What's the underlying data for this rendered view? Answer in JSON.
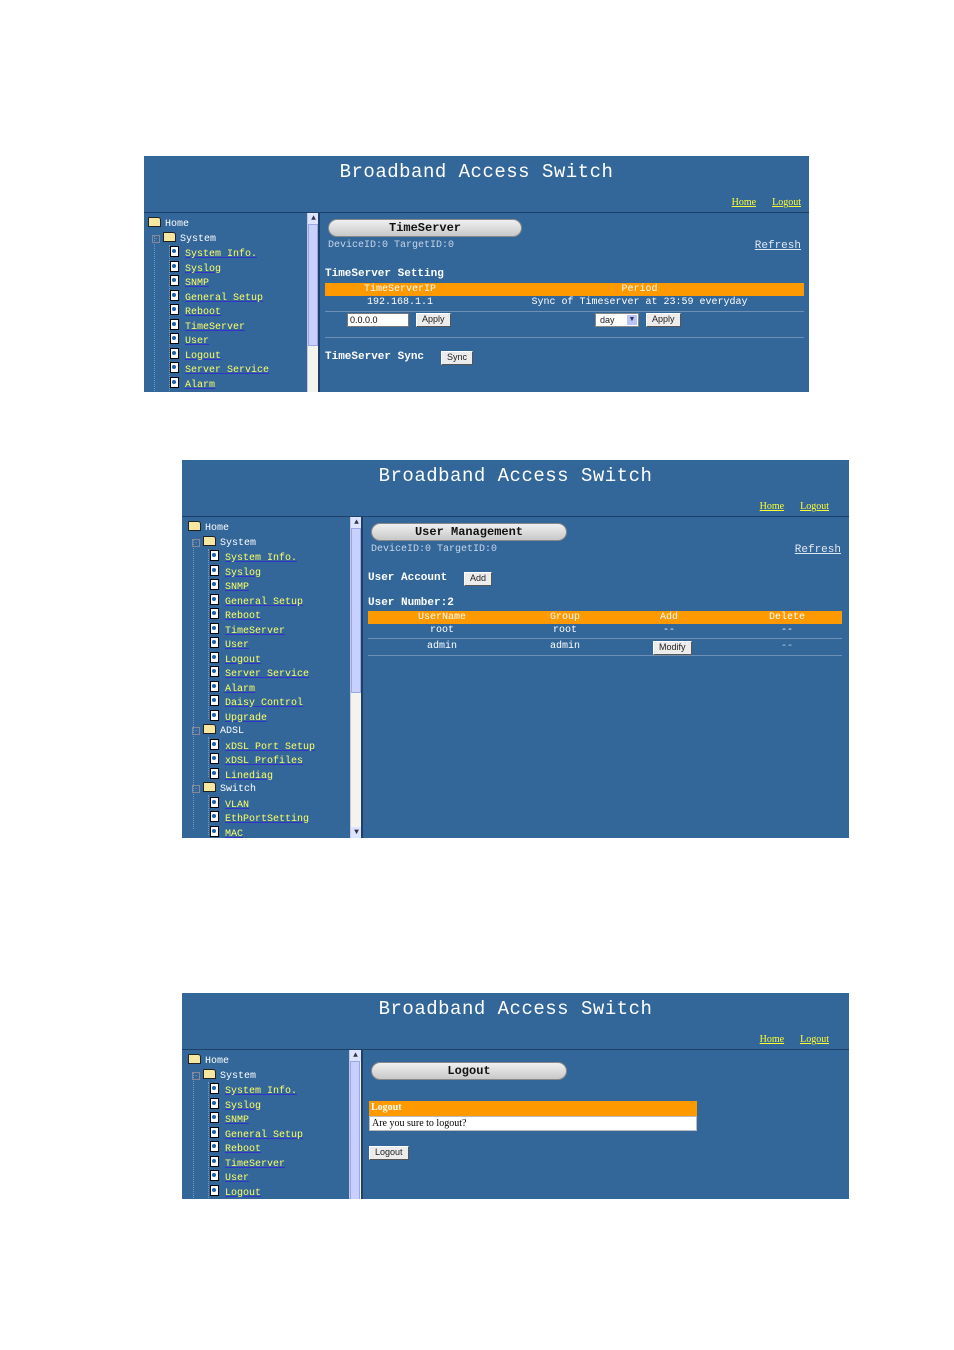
{
  "app_title": "Broadband Access Switch",
  "header_links": {
    "home": "Home",
    "logout": "Logout"
  },
  "colors": {
    "background": "#336699",
    "accent": "#ff9900",
    "link": "#ffff33"
  },
  "screens": {
    "timeserver": {
      "tree": {
        "root": "Home",
        "system_folder": "System",
        "items": [
          "System Info.",
          "Syslog",
          "SNMP",
          "General Setup",
          "Reboot",
          "TimeServer",
          "User",
          "Logout",
          "Server Service",
          "Alarm"
        ]
      },
      "page_title": "TimeServer",
      "device_info": "DeviceID:0 TargetID:0",
      "refresh": "Refresh",
      "setting_heading": "TimeServer Setting",
      "table": {
        "headers": [
          "TimeServerIP",
          "Period"
        ],
        "row": [
          "192.168.1.1",
          "Sync of Timeserver at 23:59 everyday"
        ]
      },
      "ip_input_value": "0.0.0.0",
      "apply_label": "Apply",
      "period_select_value": "day",
      "sync_heading": "TimeServer Sync",
      "sync_label": "Sync"
    },
    "user_management": {
      "tree": {
        "root": "Home",
        "system_folder": "System",
        "system_items": [
          "System Info.",
          "Syslog",
          "SNMP",
          "General Setup",
          "Reboot",
          "TimeServer",
          "User",
          "Logout",
          "Server Service",
          "Alarm",
          "Daisy Control",
          "Upgrade"
        ],
        "adsl_folder": "ADSL",
        "adsl_items": [
          "xDSL Port Setup",
          "xDSL Profiles",
          "Linediag"
        ],
        "switch_folder": "Switch",
        "switch_items": [
          "VLAN",
          "EthPortSetting",
          "MAC"
        ]
      },
      "page_title": "User Management",
      "device_info": "DeviceID:0 TargetID:0",
      "refresh": "Refresh",
      "user_account_label": "User Account",
      "add_label": "Add",
      "user_number": "User Number:2",
      "table": {
        "headers": [
          "UserName",
          "Group",
          "Add",
          "Delete"
        ],
        "rows": [
          [
            "root",
            "root",
            "--",
            "--"
          ],
          [
            "admin",
            "admin",
            "Modify",
            "--"
          ]
        ]
      }
    },
    "logout": {
      "tree": {
        "root": "Home",
        "system_folder": "System",
        "items": [
          "System Info.",
          "Syslog",
          "SNMP",
          "General Setup",
          "Reboot",
          "TimeServer",
          "User",
          "Logout"
        ]
      },
      "page_title": "Logout",
      "confirm_header": "Logout",
      "confirm_text": "Are you sure to logout?",
      "logout_button": "Logout"
    }
  }
}
